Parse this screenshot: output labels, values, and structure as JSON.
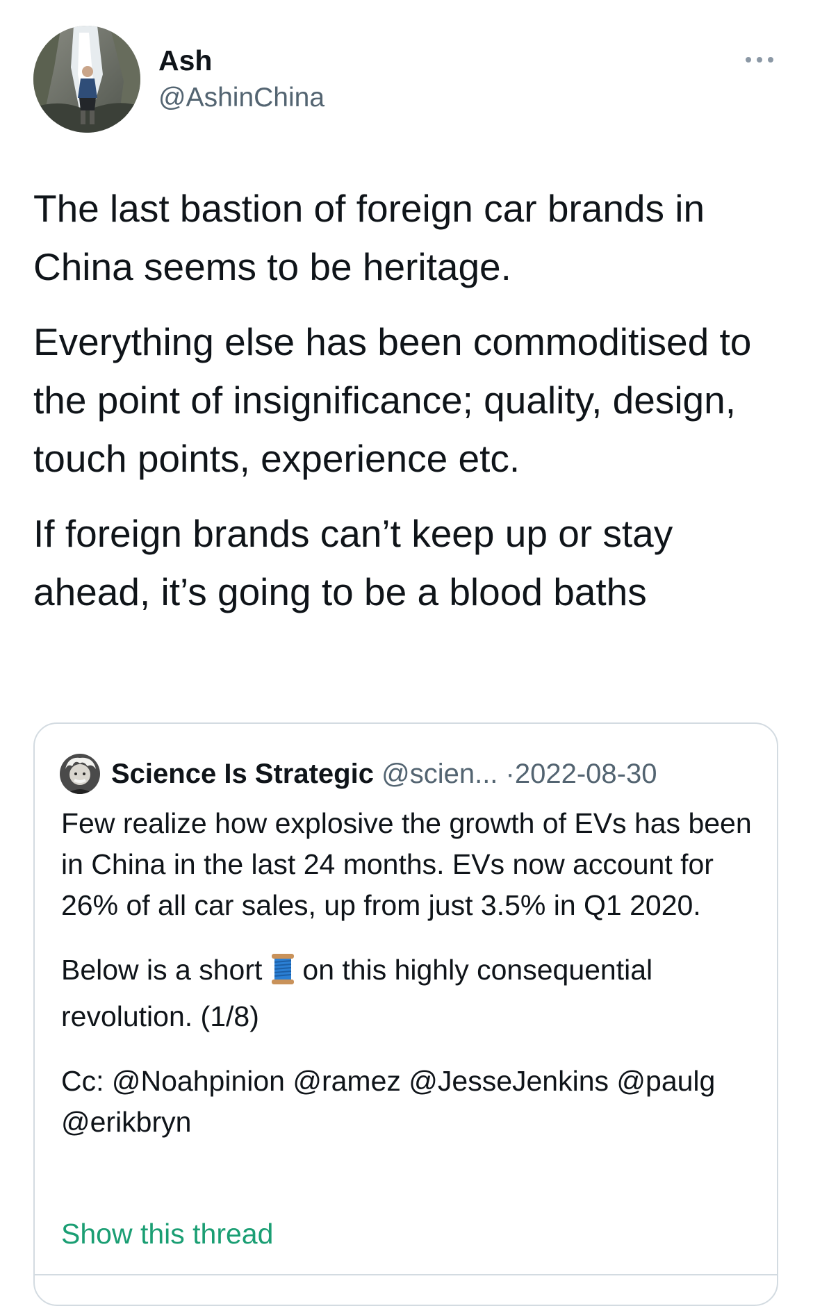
{
  "tweet": {
    "author_name": "Ash",
    "author_handle": "@AshinChina",
    "more_icon": "ellipsis-icon",
    "paragraphs": [
      "The last bastion of foreign car brands in China seems to be heritage.",
      "Everything else has been commoditised to the point of insignificance; quality, design, touch points, experience etc.",
      "If foreign brands can’t keep up or stay ahead, it’s going to be a blood baths"
    ]
  },
  "quoted_tweet": {
    "author_name": "Science Is Strategic",
    "author_handle": "@scien...",
    "separator": "·",
    "date": "2022-08-30",
    "paragraph_1": "Few realize how explosive the growth of EVs has been in China in the last 24 months. EVs now account for 26% of all car sales, up from just 3.5% in Q1 2020.",
    "paragraph_2_before": "Below is a short",
    "paragraph_2_emoji": "thread-spool-emoji",
    "paragraph_2_after": "on this highly consequential revolution. (1/8)",
    "paragraph_3": "Cc: @Noahpinion @ramez @JesseJenkins @paulg @erikbryn",
    "show_thread_label": "Show this thread"
  },
  "colors": {
    "text_primary": "#0f1419",
    "text_secondary": "#536471",
    "border": "#d3dbe1",
    "show_thread_link": "#1a9e73"
  }
}
